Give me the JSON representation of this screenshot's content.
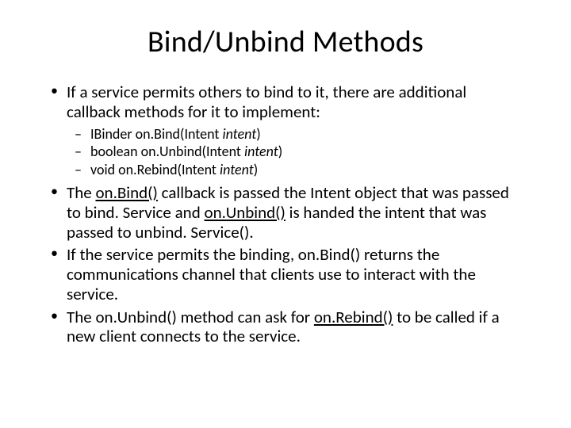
{
  "title": "Bind/Unbind Methods",
  "b1": {
    "text": "If a service permits others to bind to it, there are additional callback methods for it to implement:",
    "s1a": "IBinder on.Bind(Intent ",
    "s1b": "intent",
    "s1c": ")",
    "s2a": "boolean on.Unbind(Intent ",
    "s2b": "intent",
    "s2c": ")",
    "s3a": "void on.Rebind(Intent ",
    "s3b": "intent",
    "s3c": ")"
  },
  "b2": {
    "p1": "The ",
    "u1": "on.Bind()",
    "p2": " callback is passed the Intent object that was passed to bind. Service and ",
    "u2": "on.Unbind()",
    "p3": " is handed the intent that was passed to unbind. Service()."
  },
  "b3": "If the service permits the binding, on.Bind() returns the communications channel that clients use to interact with the service.",
  "b4": {
    "p1": "The on.Unbind() method can ask for ",
    "u1": "on.Rebind()",
    "p2": " to be called if a new client connects to the service."
  }
}
